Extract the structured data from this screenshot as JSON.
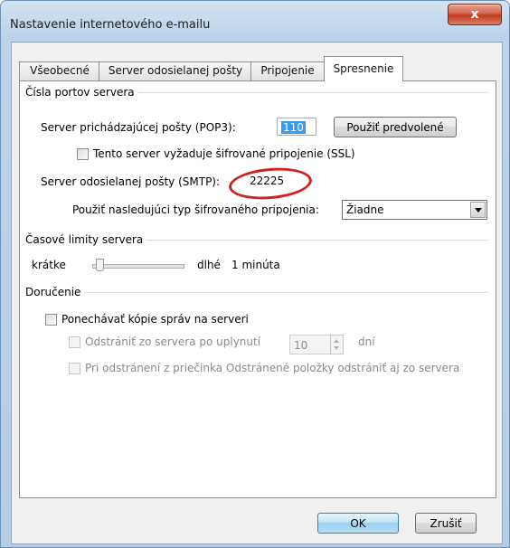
{
  "window": {
    "title": "Nastavenie internetového e-mailu",
    "close_glyph": "x"
  },
  "tabs": [
    {
      "label": "Všeobecné"
    },
    {
      "label": "Server odosielanej pošty"
    },
    {
      "label": "Pripojenie"
    },
    {
      "label": "Spresnenie"
    }
  ],
  "ports": {
    "group_label": "Čísla portov servera",
    "pop3_label": "Server prichádzajúcej pošty (POP3):",
    "pop3_value": "110",
    "default_button": "Použiť predvolené",
    "ssl_label": "Tento server vyžaduje šifrované pripojenie (SSL)",
    "smtp_label": "Server odosielanej pošty (SMTP):",
    "smtp_value": "22225",
    "encryption_label": "Použiť nasledujúci typ šifrovaného pripojenia:",
    "encryption_value": "Žiadne"
  },
  "timeouts": {
    "group_label": "Časové limity servera",
    "short_label": "krátke",
    "long_label": "dlhé",
    "value_text": "1 minúta"
  },
  "delivery": {
    "group_label": "Doručenie",
    "keep_copy_label": "Ponechávať kópie správ na serveri",
    "remove_after_label": "Odstrániť zo servera po uplynutí",
    "days_value": "10",
    "days_unit": "dní",
    "remove_deleted_label": "Pri odstránení z priečinka Odstránené položky odstrániť aj zo servera"
  },
  "footer": {
    "ok_label": "OK",
    "cancel_label": "Zrušiť"
  },
  "colors": {
    "annotation_red": "#d21f1f",
    "selection_blue": "#3399ff"
  }
}
